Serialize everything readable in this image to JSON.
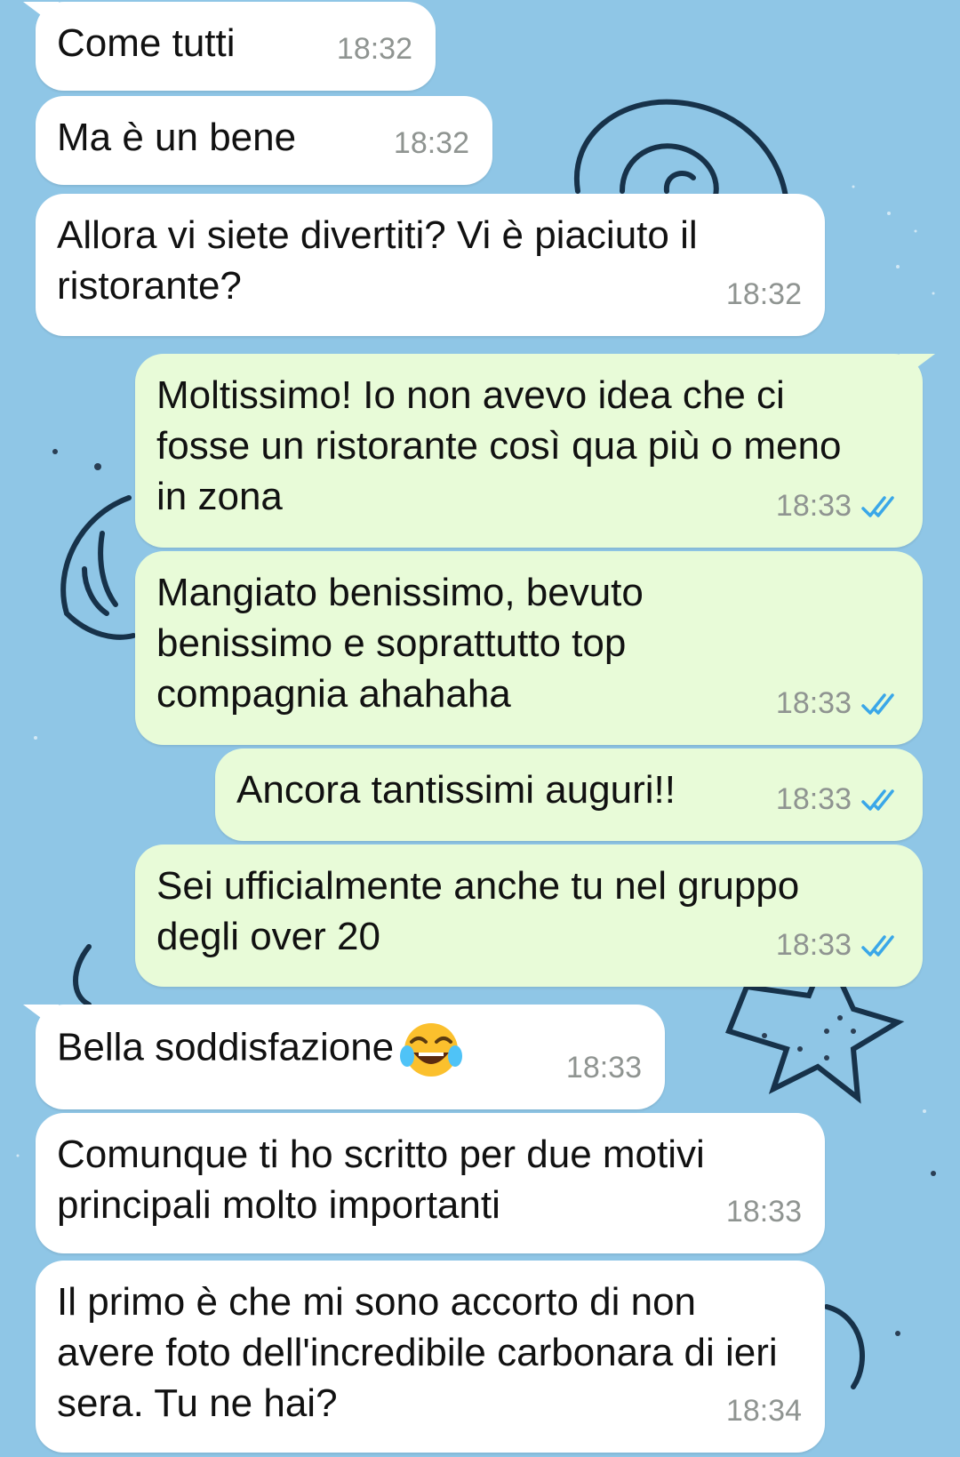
{
  "colors": {
    "wallpaper": "#8fc6e6",
    "incoming_bubble": "#ffffff",
    "outgoing_bubble": "#e8fbd8",
    "timestamp": "#8f9491",
    "read_ticks": "#3aa7e8"
  },
  "messages": [
    {
      "direction": "in",
      "text": "Come tutti",
      "time": "18:32"
    },
    {
      "direction": "in",
      "text": "Ma è un bene",
      "time": "18:32"
    },
    {
      "direction": "in",
      "text": "Allora vi siete divertiti? Vi è piaciuto il ristorante?",
      "time": "18:32"
    },
    {
      "direction": "out",
      "text": "Moltissimo! Io non avevo idea che ci fosse un ristorante così qua più o meno in zona",
      "time": "18:33",
      "status_icon": "double-check-icon"
    },
    {
      "direction": "out",
      "text": "Mangiato benissimo, bevuto benissimo e soprattutto top compagnia ahahaha",
      "time": "18:33",
      "status_icon": "double-check-icon"
    },
    {
      "direction": "out",
      "text": "Ancora tantissimi auguri!!",
      "time": "18:33",
      "status_icon": "double-check-icon"
    },
    {
      "direction": "out",
      "text": "Sei ufficialmente anche tu nel gruppo degli over 20",
      "time": "18:33",
      "status_icon": "double-check-icon"
    },
    {
      "direction": "in",
      "text": "Bella soddisfazione",
      "emoji": "tears-of-joy-emoji",
      "time": "18:33"
    },
    {
      "direction": "in",
      "text": "Comunque ti ho scritto per due motivi principali molto importanti",
      "time": "18:33"
    },
    {
      "direction": "in",
      "text": "Il primo è che mi sono accorto di non avere foto dell'incredibile carbonara di ieri sera. Tu ne hai?",
      "time": "18:34"
    }
  ]
}
